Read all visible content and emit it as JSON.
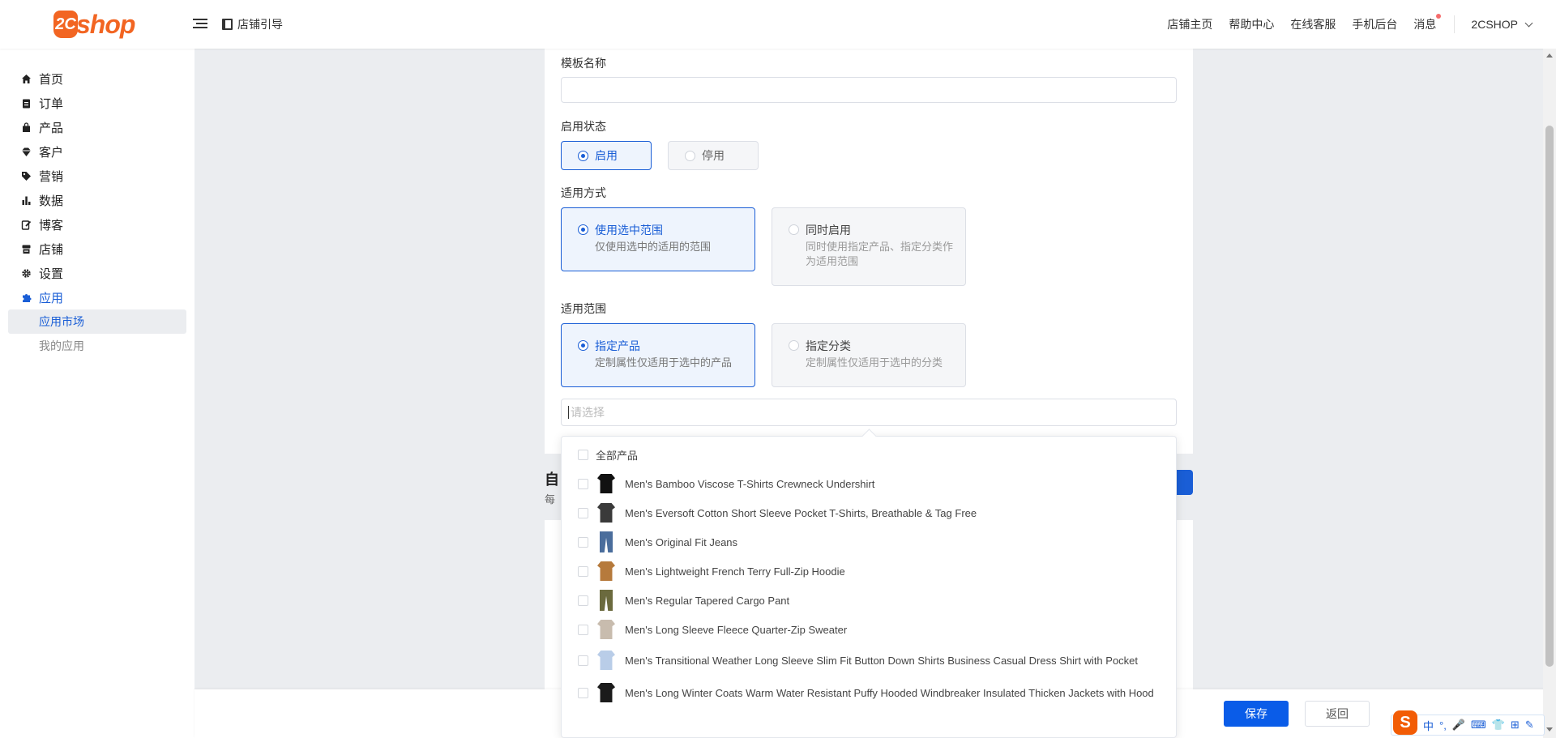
{
  "header": {
    "logo_mark": "2C",
    "logo_text": "shop",
    "guide_label": "店铺引导",
    "nav": [
      "店铺主页",
      "帮助中心",
      "在线客服",
      "手机后台",
      "消息"
    ],
    "user": "2CSHOP"
  },
  "sidebar": {
    "items": [
      {
        "label": "首页",
        "icon": "home-icon"
      },
      {
        "label": "订单",
        "icon": "clipboard-icon"
      },
      {
        "label": "产品",
        "icon": "bag-icon"
      },
      {
        "label": "客户",
        "icon": "diamond-icon"
      },
      {
        "label": "营销",
        "icon": "tag-icon"
      },
      {
        "label": "数据",
        "icon": "bar-chart-icon"
      },
      {
        "label": "博客",
        "icon": "edit-icon"
      },
      {
        "label": "店铺",
        "icon": "store-icon"
      },
      {
        "label": "设置",
        "icon": "gear-icon"
      },
      {
        "label": "应用",
        "icon": "puzzle-icon"
      }
    ],
    "sub_items": [
      "应用市场",
      "我的应用"
    ],
    "active_color": "#1a5ed6"
  },
  "form": {
    "template_name_label": "模板名称",
    "template_name_value": "",
    "status_label": "启用状态",
    "status_options": [
      "启用",
      "停用"
    ],
    "apply_mode_label": "适用方式",
    "apply_modes": [
      {
        "title": "使用选中范围",
        "desc": "仅使用选中的适用的范围"
      },
      {
        "title": "同时启用",
        "desc": "同时使用指定产品、指定分类作为适用范围"
      }
    ],
    "scope_label": "适用范围",
    "scopes": [
      {
        "title": "指定产品",
        "desc": "定制属性仅适用于选中的产品"
      },
      {
        "title": "指定分类",
        "desc": "定制属性仅适用于选中的分类"
      }
    ],
    "select_placeholder": "请选择"
  },
  "background_section": {
    "title": "自",
    "desc": "每"
  },
  "dropdown": {
    "all_label": "全部产品",
    "products": [
      {
        "name": "Men's Bamboo Viscose T-Shirts Crewneck Undershirt",
        "color": "#111111",
        "kind": "shirt"
      },
      {
        "name": "Men's Eversoft Cotton Short Sleeve Pocket T-Shirts, Breathable & Tag Free",
        "color": "#3a3a3a",
        "kind": "shirt"
      },
      {
        "name": "Men's Original Fit Jeans",
        "color": "#4a6d9c",
        "kind": "pants"
      },
      {
        "name": "Men's Lightweight French Terry Full-Zip Hoodie",
        "color": "#b67a3c",
        "kind": "shirt"
      },
      {
        "name": "Men's Regular Tapered Cargo Pant",
        "color": "#6b6a3e",
        "kind": "pants"
      },
      {
        "name": "Men's Long Sleeve Fleece Quarter-Zip Sweater",
        "color": "#c8bcae",
        "kind": "shirt"
      },
      {
        "name": "Men's Transitional Weather Long Sleeve Slim Fit Button Down Shirts Business Casual Dress Shirt with Pocket",
        "color": "#b9cde8",
        "kind": "shirt"
      },
      {
        "name": "Men's Long Winter Coats Warm Water Resistant Puffy Hooded Windbreaker Insulated Thicken Jackets with Hood",
        "color": "#1b1b1b",
        "kind": "shirt"
      }
    ]
  },
  "footer": {
    "save_label": "保存",
    "back_label": "返回"
  },
  "ime": {
    "logo": "S",
    "items": [
      "中",
      "°,",
      "🎤",
      "⌨",
      "👕",
      "⊞",
      "✎"
    ]
  }
}
